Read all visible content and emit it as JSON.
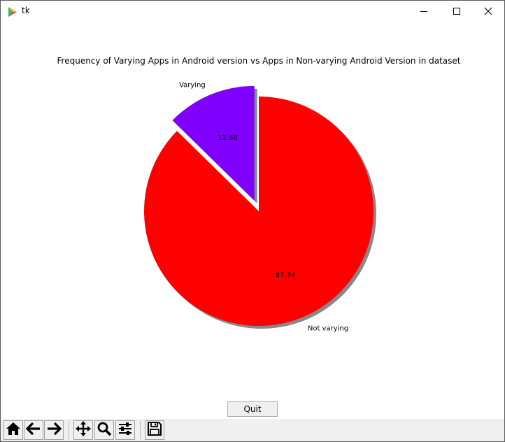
{
  "window": {
    "title": "tk",
    "controls": [
      "minimize-icon",
      "maximize-icon",
      "close-icon"
    ]
  },
  "chart_data": {
    "type": "pie",
    "title": "Frequency of Varying Apps in Android version vs Apps in Non-varying Android Version in dataset",
    "slices": [
      {
        "label": "Varying",
        "value": 12.66,
        "pct_label": "12.66",
        "color": "#8000ff",
        "exploded": true
      },
      {
        "label": "Not varying",
        "value": 87.34,
        "pct_label": "87.34",
        "color": "#ff0000",
        "exploded": false
      }
    ],
    "shadow": true,
    "start_angle_deg": 90,
    "counterclock": true
  },
  "controls": {
    "quit_label": "Quit"
  },
  "toolbar": {
    "buttons": [
      "home-icon",
      "back-icon",
      "forward-icon",
      "pan-icon",
      "zoom-icon",
      "configure-subplots-icon",
      "save-icon"
    ]
  }
}
